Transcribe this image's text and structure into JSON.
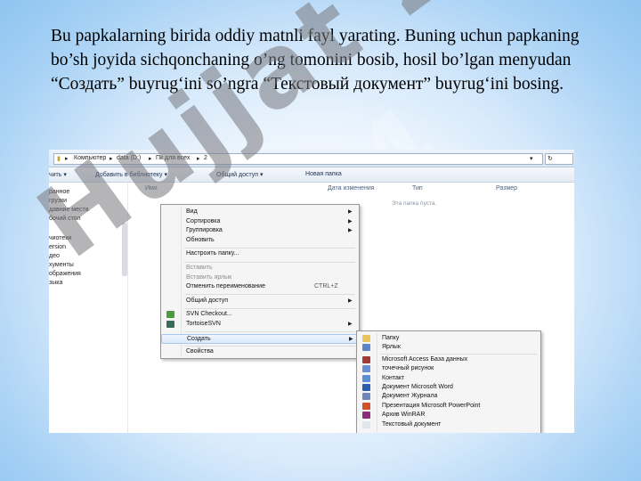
{
  "slide": {
    "text": "Bu papkalarning birida oddiy matnli fayl yarating. Buning uchun papkaning bo’sh joyida sichqonchaning o’ng tomonini bosib, hosil bo’lgan menyudan “Создать” buyrug‘ini so’ngra “Текстовый документ” buyrug‘ini bosing.",
    "watermark": "Hujjat 24"
  },
  "explorer": {
    "path": [
      "Компьютер",
      "data (D:)",
      "Пк для всех",
      "2"
    ],
    "toolbar": [
      "чить ▾",
      "Добавить в библиотеку ▾",
      "Общий доступ ▾",
      "Новая папка"
    ],
    "nav_items": [
      "ранное",
      "грузки",
      "давние места",
      "бочий стол",
      "",
      "чиотеки",
      "ersion",
      "део",
      "хументы",
      "ображения",
      "зыка"
    ],
    "columns": [
      "Имя",
      "Дата изменения",
      "Тип",
      "Размер"
    ],
    "empty_text": "Эта папка пуста."
  },
  "context_menu": {
    "items": [
      {
        "label": "Вид",
        "arrow": true
      },
      {
        "label": "Сортировка",
        "arrow": true
      },
      {
        "label": "Группировка",
        "arrow": true
      },
      {
        "label": "Обновить"
      },
      {
        "sep": true
      },
      {
        "label": "Настроить папку..."
      },
      {
        "sep": true
      },
      {
        "label": "Вставить",
        "disabled": true
      },
      {
        "label": "Вставить ярлык",
        "disabled": true
      },
      {
        "label": "Отменить переименование",
        "shortcut": "CTRL+Z"
      },
      {
        "sep": true
      },
      {
        "label": "Общий доступ",
        "arrow": true
      },
      {
        "sep": true
      },
      {
        "label": "SVN Checkout...",
        "icon": "svn-icon"
      },
      {
        "label": "TortoiseSVN",
        "arrow": true,
        "icon": "tortoise-icon"
      },
      {
        "sep": true
      },
      {
        "label": "Создать",
        "arrow": true,
        "highlight": true
      },
      {
        "sep": true
      },
      {
        "label": "Свойства"
      }
    ]
  },
  "submenu": {
    "items": [
      {
        "label": "Папку",
        "icon": "folder-icon",
        "color": "#e8c45a"
      },
      {
        "label": "Ярлык",
        "icon": "shortcut-icon",
        "color": "#5a86c8"
      },
      {
        "sep": true
      },
      {
        "label": "Microsoft Access База данных",
        "icon": "access-icon",
        "color": "#a33b3b"
      },
      {
        "label": "точечный рисунок",
        "icon": "bitmap-icon",
        "color": "#6a8fd0"
      },
      {
        "label": "Контакт",
        "icon": "contact-icon",
        "color": "#5b8ed6"
      },
      {
        "label": "Документ Microsoft Word",
        "icon": "word-icon",
        "color": "#2d5fb0"
      },
      {
        "label": "Документ Журнала",
        "icon": "journal-icon",
        "color": "#6f86b8"
      },
      {
        "label": "Презентация Microsoft PowerPoint",
        "icon": "powerpoint-icon",
        "color": "#d0502a"
      },
      {
        "label": "Архив WinRAR",
        "icon": "winrar-icon",
        "color": "#8b2f7c"
      },
      {
        "label": "Текстовый документ",
        "icon": "text-document-icon",
        "color": "#dfe6ee"
      }
    ]
  }
}
